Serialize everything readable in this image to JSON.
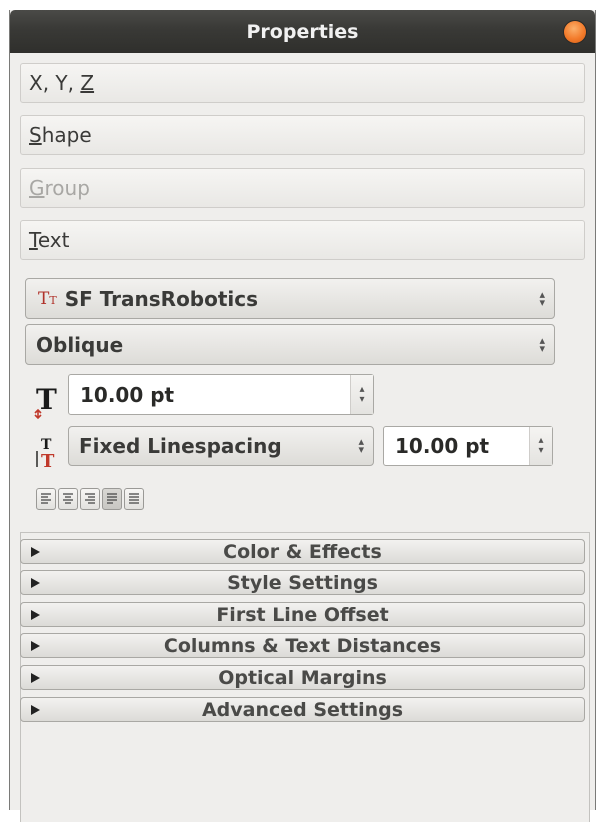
{
  "window": {
    "title": "Properties"
  },
  "sections": [
    {
      "label": "X, Y, Z",
      "mnemonic": "Z",
      "enabled": true
    },
    {
      "label": "Shape",
      "mnemonic": "S",
      "enabled": true
    },
    {
      "label": "Group",
      "mnemonic": "G",
      "enabled": false
    },
    {
      "label": "Text",
      "mnemonic": "T",
      "enabled": true
    }
  ],
  "text_panel": {
    "font_family": "SF TransRobotics",
    "font_style": "Oblique",
    "font_size": "10.00 pt",
    "linespacing_mode": "Fixed Linespacing",
    "linespacing_value": "10.00 pt",
    "alignment_buttons": [
      {
        "name": "align-left",
        "icon": "align-left-icon"
      },
      {
        "name": "align-center",
        "icon": "align-center-icon"
      },
      {
        "name": "align-right",
        "icon": "align-right-icon"
      },
      {
        "name": "align-justify",
        "icon": "align-justify-icon",
        "active": true
      },
      {
        "name": "align-forced-justify",
        "icon": "align-forced-justify-icon"
      }
    ]
  },
  "expanders": [
    {
      "label": "Color & Effects"
    },
    {
      "label": "Style Settings"
    },
    {
      "label": "First Line Offset"
    },
    {
      "label": "Columns & Text Distances"
    },
    {
      "label": "Optical Margins"
    },
    {
      "label": "Advanced Settings"
    }
  ],
  "colors": {
    "titlebar": "#393936",
    "close_button": "#f37b2b",
    "panel_bg": "#efeeec",
    "icon_red": "#c0392b"
  }
}
